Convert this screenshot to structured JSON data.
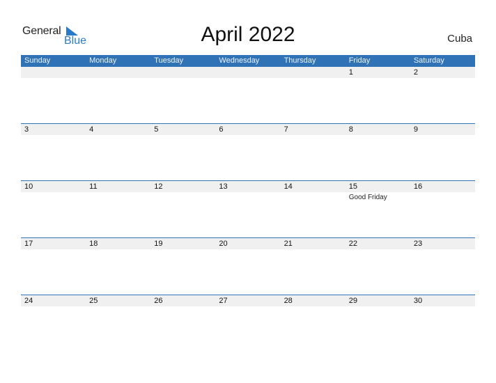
{
  "logo": {
    "word1": "General",
    "word2": "Blue"
  },
  "title": "April 2022",
  "country": "Cuba",
  "colors": {
    "header_bg": "#2f73b6",
    "day_row_bg": "#f0f0f0",
    "logo_blue": "#2a7bc6"
  },
  "weekdays": [
    "Sunday",
    "Monday",
    "Tuesday",
    "Wednesday",
    "Thursday",
    "Friday",
    "Saturday"
  ],
  "weeks": [
    {
      "days": [
        "",
        "",
        "",
        "",
        "",
        "1",
        "2"
      ],
      "events": [
        "",
        "",
        "",
        "",
        "",
        "",
        ""
      ]
    },
    {
      "days": [
        "3",
        "4",
        "5",
        "6",
        "7",
        "8",
        "9"
      ],
      "events": [
        "",
        "",
        "",
        "",
        "",
        "",
        ""
      ]
    },
    {
      "days": [
        "10",
        "11",
        "12",
        "13",
        "14",
        "15",
        "16"
      ],
      "events": [
        "",
        "",
        "",
        "",
        "",
        "Good Friday",
        ""
      ]
    },
    {
      "days": [
        "17",
        "18",
        "19",
        "20",
        "21",
        "22",
        "23"
      ],
      "events": [
        "",
        "",
        "",
        "",
        "",
        "",
        ""
      ]
    },
    {
      "days": [
        "24",
        "25",
        "26",
        "27",
        "28",
        "29",
        "30"
      ],
      "events": [
        "",
        "",
        "",
        "",
        "",
        "",
        ""
      ]
    }
  ]
}
